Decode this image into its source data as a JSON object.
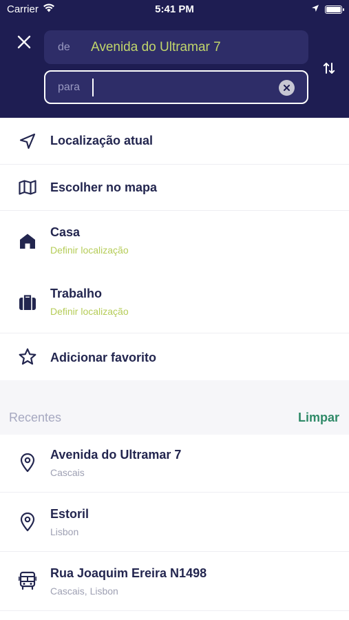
{
  "status_bar": {
    "carrier": "Carrier",
    "time": "5:41 PM"
  },
  "search": {
    "from_prefix": "de",
    "from_value": "Avenida do Ultramar 7",
    "to_prefix": "para",
    "to_value": ""
  },
  "options": {
    "current_location": "Localização atual",
    "choose_on_map": "Escolher no mapa",
    "home_title": "Casa",
    "home_subtitle": "Definir localização",
    "work_title": "Trabalho",
    "work_subtitle": "Definir localização",
    "add_favorite": "Adicionar favorito"
  },
  "recents": {
    "label": "Recentes",
    "clear_label": "Limpar",
    "items": [
      {
        "title": "Avenida do Ultramar 7",
        "subtitle": "Cascais",
        "icon": "pin-icon"
      },
      {
        "title": "Estoril",
        "subtitle": "Lisbon",
        "icon": "pin-icon"
      },
      {
        "title": "Rua Joaquim Ereira N1498",
        "subtitle": "Cascais, Lisbon",
        "icon": "bus-icon"
      }
    ]
  },
  "colors": {
    "header_bg": "#1e1d52",
    "field_bg": "#2e2d68",
    "accent_green": "#c1d66b",
    "link_green": "#2f8a68",
    "text_dark": "#23264f"
  }
}
